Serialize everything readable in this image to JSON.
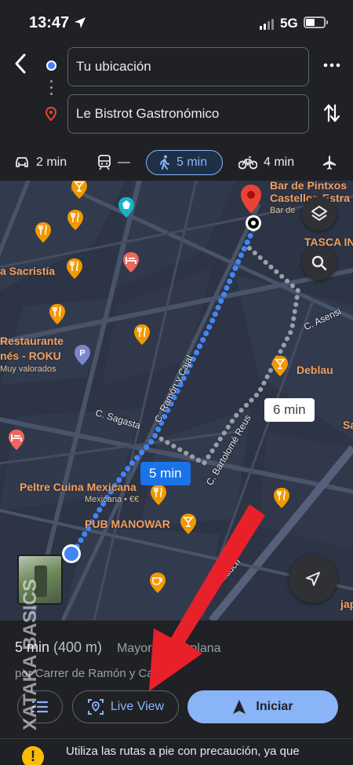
{
  "status_bar": {
    "time": "13:47",
    "network": "5G"
  },
  "route": {
    "origin": "Tu ubicación",
    "destination": "Le Bistrot Gastronómico"
  },
  "modes": [
    {
      "id": "car",
      "label": "2 min",
      "icon": "car-icon"
    },
    {
      "id": "transit",
      "label": "—",
      "icon": "train-icon"
    },
    {
      "id": "walk",
      "label": "5 min",
      "icon": "walking-icon",
      "selected": true
    },
    {
      "id": "bike",
      "label": "4 min",
      "icon": "bike-icon"
    },
    {
      "id": "flight",
      "label": "",
      "icon": "plane-icon"
    }
  ],
  "map": {
    "places": {
      "pintxos": "Bar de Pintxos",
      "castellon": "Castellon Estra",
      "bar_de": "Bar de",
      "tasca": "TASCA IN",
      "sacristia": "a Sacristía",
      "restaurante": "Restaurante",
      "roku": "nés - ROKU",
      "valorados": "Muy valorados",
      "deblau": "Deblau",
      "peltre": "Peltre Cuina Mexicana",
      "mexicana": "Mexicana • €€",
      "manowar": "PUB MANOWAR",
      "sa": "Sa",
      "jap": "jap"
    },
    "streets": {
      "ramon_y_cajal": "C. Ramón y Cajal",
      "asensi": "C. Asensi",
      "sagasta": "C. Sagasta",
      "bartolome": "C. Bartolomé Reus",
      "casalduch": "Av. de Casalduch"
    },
    "chips": {
      "walk_time": "5 min",
      "alt_time": "6 min"
    }
  },
  "sheet": {
    "duration": "5 min",
    "distance": "(400 m)",
    "description": "Mayormente plana",
    "via": "por Carrer de Ramón y Cajal",
    "live_view_label": "Live View",
    "start_label": "Iniciar",
    "warning": "Utiliza las rutas a pie con precaución, ya que"
  },
  "colors": {
    "route_blue": "#4285f4",
    "accent": "#8ab4f8",
    "arrow_red": "#e8202a",
    "pin_red": "#ea4335"
  },
  "watermark": "XATAKA BASICS"
}
